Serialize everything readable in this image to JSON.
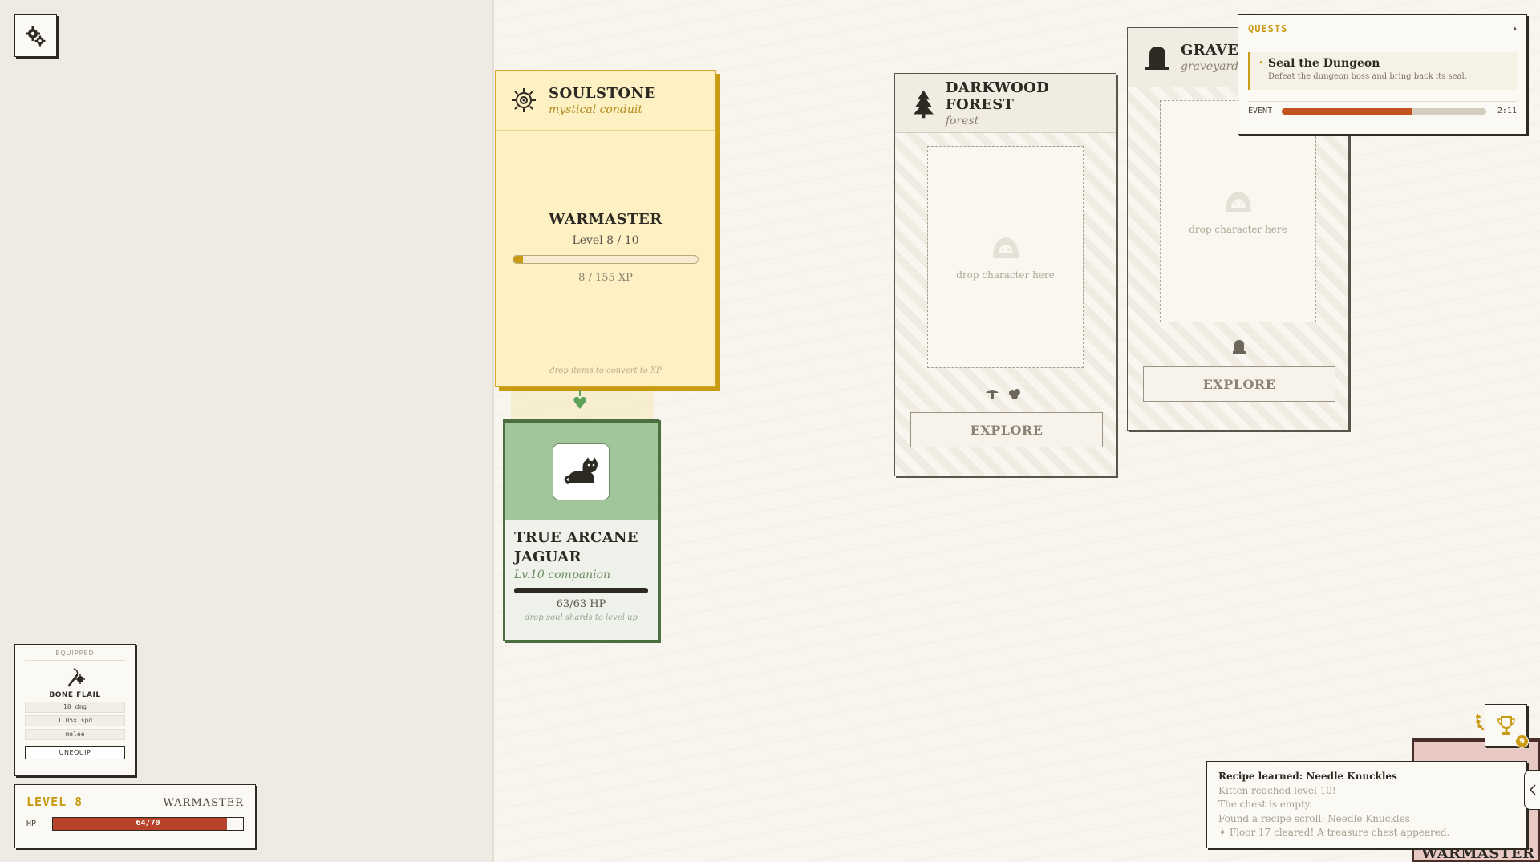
{
  "equipped": {
    "label": "EQUIPPED",
    "item_name": "BONE FLAIL",
    "stats": [
      "10 dmg",
      "1.05× spd",
      "melee"
    ],
    "unequip_label": "UNEQUIP"
  },
  "player": {
    "level_text": "LEVEL 8",
    "class_name": "WARMASTER",
    "hp_label": "HP",
    "hp_text": "64/70",
    "hp_fraction": 0.914
  },
  "soulstone": {
    "title": "SOULSTONE",
    "subtitle": "mystical conduit",
    "class_name": "WARMASTER",
    "level_text": "Level 8 / 10",
    "xp_text": "8 / 155 XP",
    "xp_fraction": 0.052,
    "hint": "drop items to convert to XP"
  },
  "companion": {
    "name": "TRUE ARCANE JAGUAR",
    "subtitle": "Lv.10 companion",
    "hp_text": "63/63 HP",
    "hint": "drop soul shards to level up"
  },
  "locations": [
    {
      "title": "DARKWOOD FOREST",
      "subtitle": "forest",
      "drop_text": "drop character here",
      "explore_label": "EXPLORE"
    },
    {
      "title": "GRAVEYA",
      "subtitle": "graveyard",
      "drop_text": "drop character here",
      "explore_label": "EXPLORE"
    }
  ],
  "quests": {
    "title": "QUESTS",
    "collapse_icon": "▴",
    "items": [
      {
        "name": "Seal the Dungeon",
        "description": "Defeat the dungeon boss and bring back its seal."
      }
    ],
    "event_label": "EVENT",
    "event_time": "2:11",
    "event_fraction": 0.64
  },
  "log": {
    "lines": [
      "Recipe learned: Needle Knuckles",
      "Kitten reached level 10!",
      "The chest is empty.",
      "Found a recipe scroll: Needle Knuckles",
      "✦ Floor 17 cleared! A treasure chest appeared."
    ]
  },
  "achievements": {
    "badge_count": "9"
  },
  "bottom_card": {
    "label": "WARMASTER"
  },
  "colors": {
    "accent_gold": "#c99a14",
    "hp_red": "#b8432a",
    "companion_green": "#a3c59b",
    "event_orange": "#c2521f"
  }
}
